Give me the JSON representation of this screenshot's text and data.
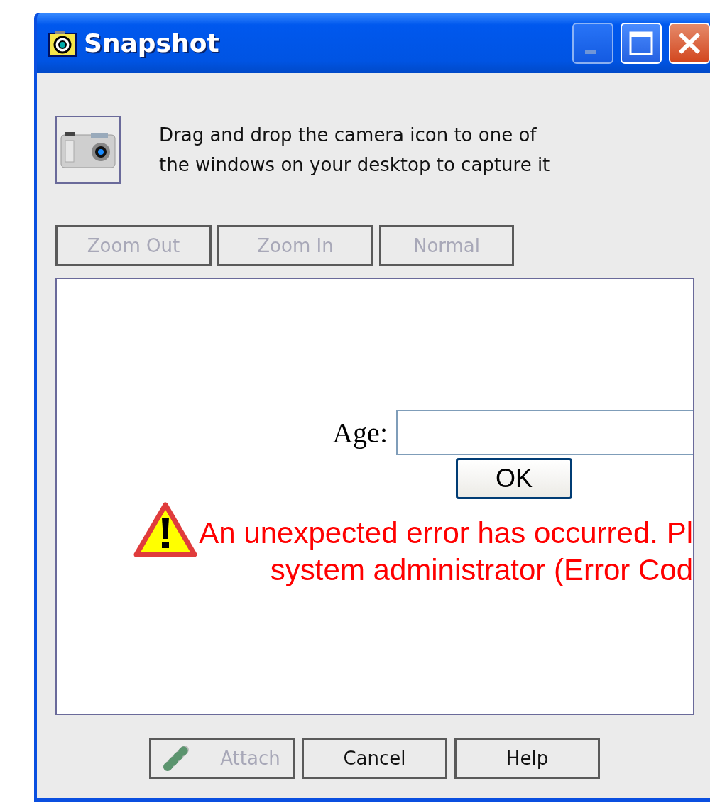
{
  "window": {
    "title": "Snapshot",
    "title_buttons": [
      {
        "kind": "minimize",
        "disabled": true
      },
      {
        "kind": "maximize",
        "disabled": false
      },
      {
        "kind": "close",
        "disabled": false
      }
    ]
  },
  "instructions": [
    "Drag and drop the camera icon to one of",
    "the windows on your desktop to capture it"
  ],
  "zoom_buttons": [
    {
      "label": "Zoom Out",
      "disabled": true
    },
    {
      "label": "Zoom In",
      "disabled": true
    },
    {
      "label": "Normal",
      "disabled": true
    }
  ],
  "preview": {
    "field_label": "Age:",
    "ok_button": "OK",
    "error_lines": [
      "An unexpected error has occurred. Pl",
      "system administrator (Error Cod"
    ]
  },
  "footer_buttons": [
    {
      "kind": "attach",
      "label": "Attach",
      "disabled": true
    },
    {
      "kind": "plain",
      "label": "Cancel",
      "disabled": false
    },
    {
      "kind": "plain",
      "label": "Help",
      "disabled": false
    }
  ]
}
